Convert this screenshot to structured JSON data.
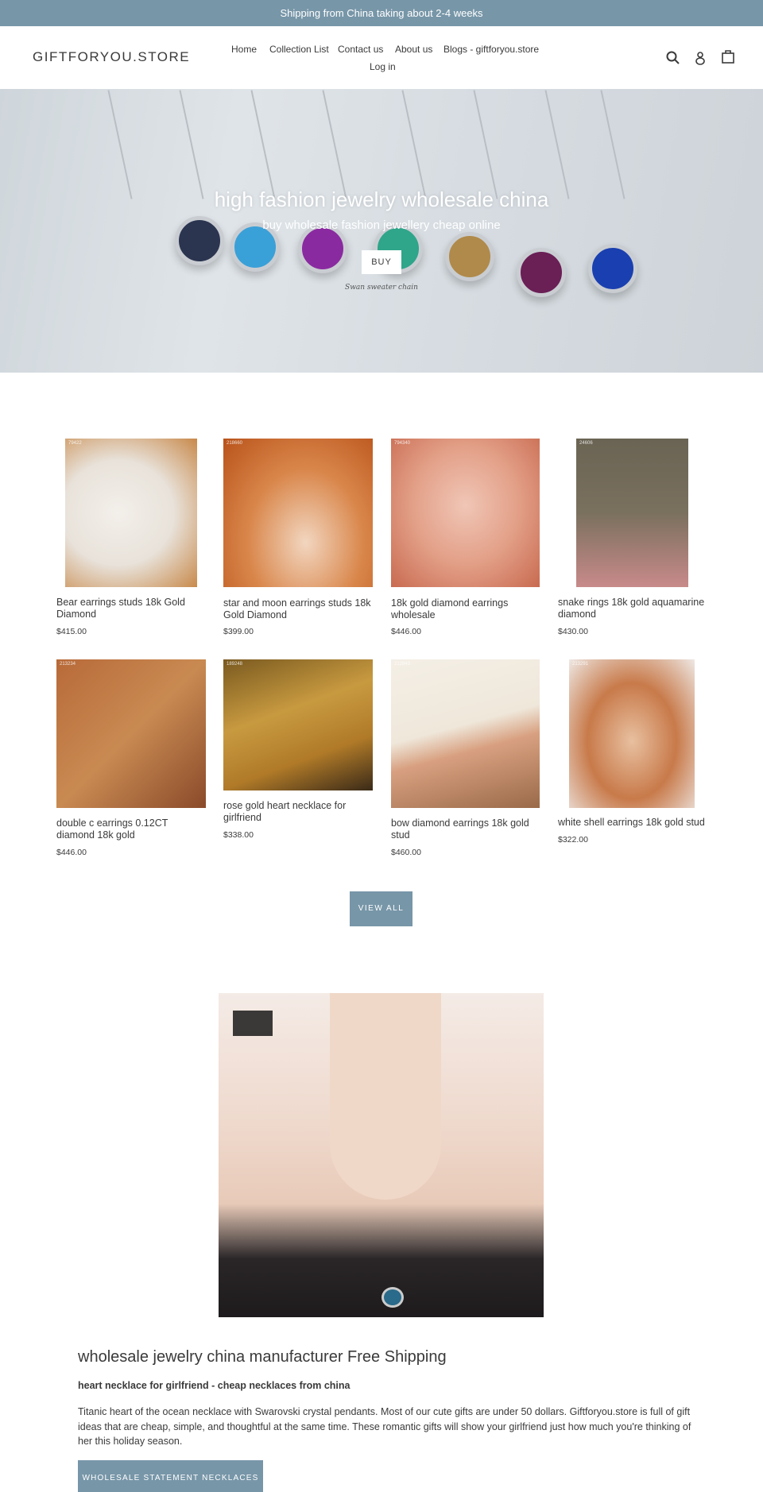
{
  "announcement": "Shipping from China taking about 2-4 weeks",
  "header": {
    "logo": "GIFTFORYOU.STORE",
    "nav": [
      "Home",
      "Collection List",
      "Contact us",
      "About us",
      "Blogs - giftforyou.store",
      "Log in"
    ],
    "icons": [
      "search-icon",
      "account-icon",
      "cart-icon"
    ]
  },
  "hero": {
    "title": "high fashion jewelry wholesale china",
    "subtitle": "buy wholesale fashion jewellery cheap online",
    "button": "BUY",
    "image_caption": "Swan sweater chain"
  },
  "products": [
    {
      "title": "Bear earrings studs 18k Gold Diamond",
      "price": "$415.00",
      "code": "79422"
    },
    {
      "title": "star and moon earrings studs 18k Gold Diamond",
      "price": "$399.00",
      "code": "218660"
    },
    {
      "title": "18k gold diamond earrings wholesale",
      "price": "$446.00",
      "code": "794340"
    },
    {
      "title": "snake rings 18k gold aquamarine diamond",
      "price": "$430.00",
      "code": "24606"
    },
    {
      "title": "double c earrings 0.12CT diamond 18k gold",
      "price": "$446.00",
      "code": "213234"
    },
    {
      "title": "rose gold heart necklace for girlfriend",
      "price": "$338.00",
      "code": "189248"
    },
    {
      "title": "bow diamond earrings 18k gold stud",
      "price": "$460.00",
      "code": "212843"
    },
    {
      "title": "white shell earrings 18k gold stud",
      "price": "$322.00",
      "code": "213291"
    }
  ],
  "view_all": "VIEW ALL",
  "feature": {
    "heading": "wholesale jewelry china manufacturer Free Shipping",
    "subheading": "heart necklace for girlfriend - cheap necklaces from china",
    "body": "Titanic heart of the ocean necklace with Swarovski crystal pendants. Most of our cute gifts are under 50 dollars. Giftforyou.store is full of gift ideas that are cheap, simple, and thoughtful at the same time. These romantic gifts will show your girlfriend just how much you're thinking of her this holiday season.",
    "button": "WHOLESALE STATEMENT NECKLACES"
  },
  "colors": {
    "accent": "#7796a8",
    "text": "#3a3a3a"
  }
}
